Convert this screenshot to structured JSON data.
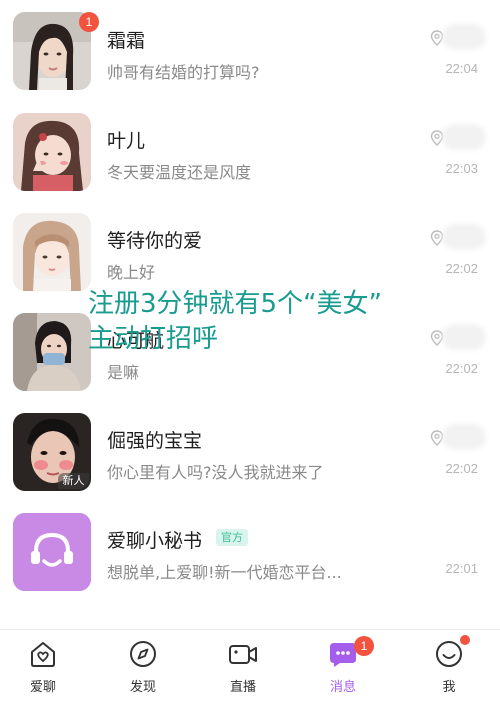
{
  "conversations": [
    {
      "name": "霜霜",
      "preview": "帅哥有结婚的打算吗?",
      "time": "22:04",
      "unread": "1"
    },
    {
      "name": "叶儿",
      "preview": "冬天要温度还是风度",
      "time": "22:03"
    },
    {
      "name": "等待你的爱",
      "preview": "晚上好",
      "time": "22:02"
    },
    {
      "name": "心可航",
      "preview": "是嘛",
      "time": "22:02"
    },
    {
      "name": "倔强的宝宝",
      "preview": "你心里有人吗?没人我就进来了",
      "time": "22:02",
      "tag": "新人"
    },
    {
      "name": "爱聊小秘书",
      "preview": "想脱单,上爱聊!新一代婚恋平台...",
      "time": "22:01",
      "tag": "官方"
    }
  ],
  "overlay_text": {
    "line1": "注册3分钟就有5个“美女”",
    "line2": "主动打招呼"
  },
  "tabbar": {
    "tabs": [
      {
        "label": "爱聊",
        "icon": "heart-home-icon"
      },
      {
        "label": "发现",
        "icon": "compass-icon"
      },
      {
        "label": "直播",
        "icon": "video-camera-icon"
      },
      {
        "label": "消息",
        "icon": "message-bubble-icon",
        "badge": "1",
        "active": true
      },
      {
        "label": "我",
        "icon": "smiley-profile-icon",
        "dot": true
      }
    ]
  },
  "colors": {
    "accent": "#a55dec",
    "badge": "#f2533f",
    "overlay_text": "#1a9b8f",
    "official_tag_bg": "#d8f4ec",
    "official_tag_text": "#3dbd95"
  }
}
